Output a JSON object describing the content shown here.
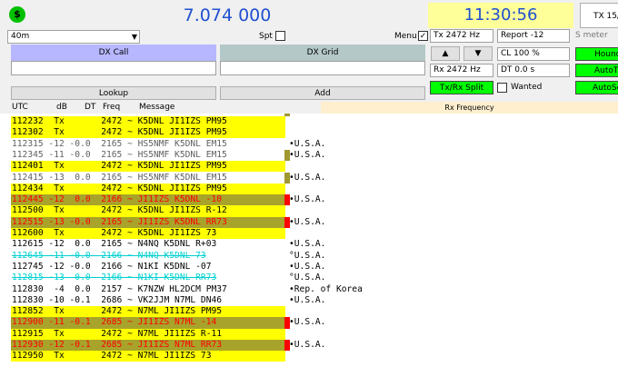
{
  "topbar": {
    "status_icon": "$",
    "frequency": "7.074 000",
    "time": "11:30:56",
    "tx_label": "TX 15/"
  },
  "controls": {
    "band": "40m",
    "spt_label": "Spt",
    "menu_label": "Menu",
    "dx_call_label": "DX Call",
    "dx_grid_label": "DX Grid",
    "dx_call_value": "",
    "dx_grid_value": "",
    "lookup_label": "Lookup",
    "add_label": "Add"
  },
  "right_panel": {
    "tx_freq": "Tx  2472  Hz",
    "rx_freq": "Rx  2472  Hz",
    "report": "Report -12",
    "s_meter": "S meter",
    "cl": "CL  100 %",
    "dt": "DT 0.0 s",
    "up_arrow": "▲",
    "down_arrow": "▼",
    "tx_rx_split": "Tx/Rx Split",
    "wanted": "Wanted",
    "hound": "Hound",
    "autotx": "AutoTx",
    "autoseq": "AutoSeq"
  },
  "table": {
    "headers": [
      "UTC",
      "dB",
      "DT",
      "Freq",
      "Message"
    ],
    "rx_frequency_label": "Rx Frequency",
    "rows": [
      {
        "line": "112232  Tx       2472 ~ K5DNL JI1IZS PM95",
        "country": "",
        "style": "tx"
      },
      {
        "line": "112302  Tx       2472 ~ K5DNL JI1IZS PM95",
        "country": "",
        "style": "tx"
      },
      {
        "line": "112315 -12 -0.0  2165 ~ HS5NMF K5DNL EM15",
        "country": "•U.S.A.",
        "style": "gray"
      },
      {
        "line": "112345 -11 -0.0  2165 ~ HS5NMF K5DNL EM15",
        "country": "•U.S.A.",
        "style": "gray"
      },
      {
        "line": "112401  Tx       2472 ~ K5DNL JI1IZS PM95",
        "country": "",
        "style": "tx"
      },
      {
        "line": "112415 -13  0.0  2165 ~ HS5NMF K5DNL EM15",
        "country": "•U.S.A.",
        "style": "gray"
      },
      {
        "line": "112434  Tx       2472 ~ K5DNL JI1IZS PM95",
        "country": "",
        "style": "tx"
      },
      {
        "line": "112445 -12  0.0  2166 ~ JI1IZS K5DNL -10",
        "country": "•U.S.A.",
        "style": "me"
      },
      {
        "line": "112500  Tx       2472 ~ K5DNL JI1IZS R-12",
        "country": "",
        "style": "tx"
      },
      {
        "line": "112515 -13 -0.0  2165 ~ JI1IZS K5DNL RR73",
        "country": "•U.S.A.",
        "style": "me"
      },
      {
        "line": "112600  Tx       2472 ~ K5DNL JI1IZS 73",
        "country": "",
        "style": "tx"
      },
      {
        "line": "112615 -12  0.0  2165 ~ N4NQ K5DNL R+03",
        "country": "•U.S.A.",
        "style": "plain"
      },
      {
        "line": "112645 -11 -0.0  2166 ~ N4NQ K5DNL 73",
        "country": "°U.S.A.",
        "style": "cyan"
      },
      {
        "line": "112745 -12 -0.0  2166 ~ N1KI K5DNL -07",
        "country": "•U.S.A.",
        "style": "plain"
      },
      {
        "line": "112815 -13  0.0  2166 ~ N1KI K5DNL RR73",
        "country": "°U.S.A.",
        "style": "cyan"
      },
      {
        "line": "112830  -4  0.0  2157 ~ K7NZW HL2DCM PM37",
        "country": "•Rep. of Korea",
        "style": "plain"
      },
      {
        "line": "112830 -10 -0.1  2686 ~ VK2JJM N7ML DN46",
        "country": "•U.S.A.",
        "style": "plain"
      },
      {
        "line": "112852  Tx       2472 ~ N7ML JI1IZS PM95",
        "country": "",
        "style": "tx"
      },
      {
        "line": "112900 -11 -0.1  2685 ~ JI1IZS N7ML -14",
        "country": "•U.S.A.",
        "style": "me"
      },
      {
        "line": "112915  Tx       2472 ~ N7ML JI1IZS R-11",
        "country": "",
        "style": "tx"
      },
      {
        "line": "112930 -12 -0.1  2685 ~ JI1IZS N7ML RR73",
        "country": "•U.S.A.",
        "style": "me"
      },
      {
        "line": "112950  Tx       2472 ~ N7ML JI1IZS 73",
        "country": "",
        "style": "tx"
      }
    ]
  },
  "colors": {
    "tx_row": "#ffff00",
    "me_row": "#a8a32a",
    "me_text": "#ff0000",
    "marker": "#a09830",
    "marker_red": "#ff0000",
    "cyan_text": "#00d0d0",
    "time_bg": "#ffff99",
    "green": "#00ff00",
    "dx_call_header": "#b7b7ff",
    "dx_grid_header": "#b4c8c8",
    "rx_freq_bg": "#ffefcf"
  }
}
